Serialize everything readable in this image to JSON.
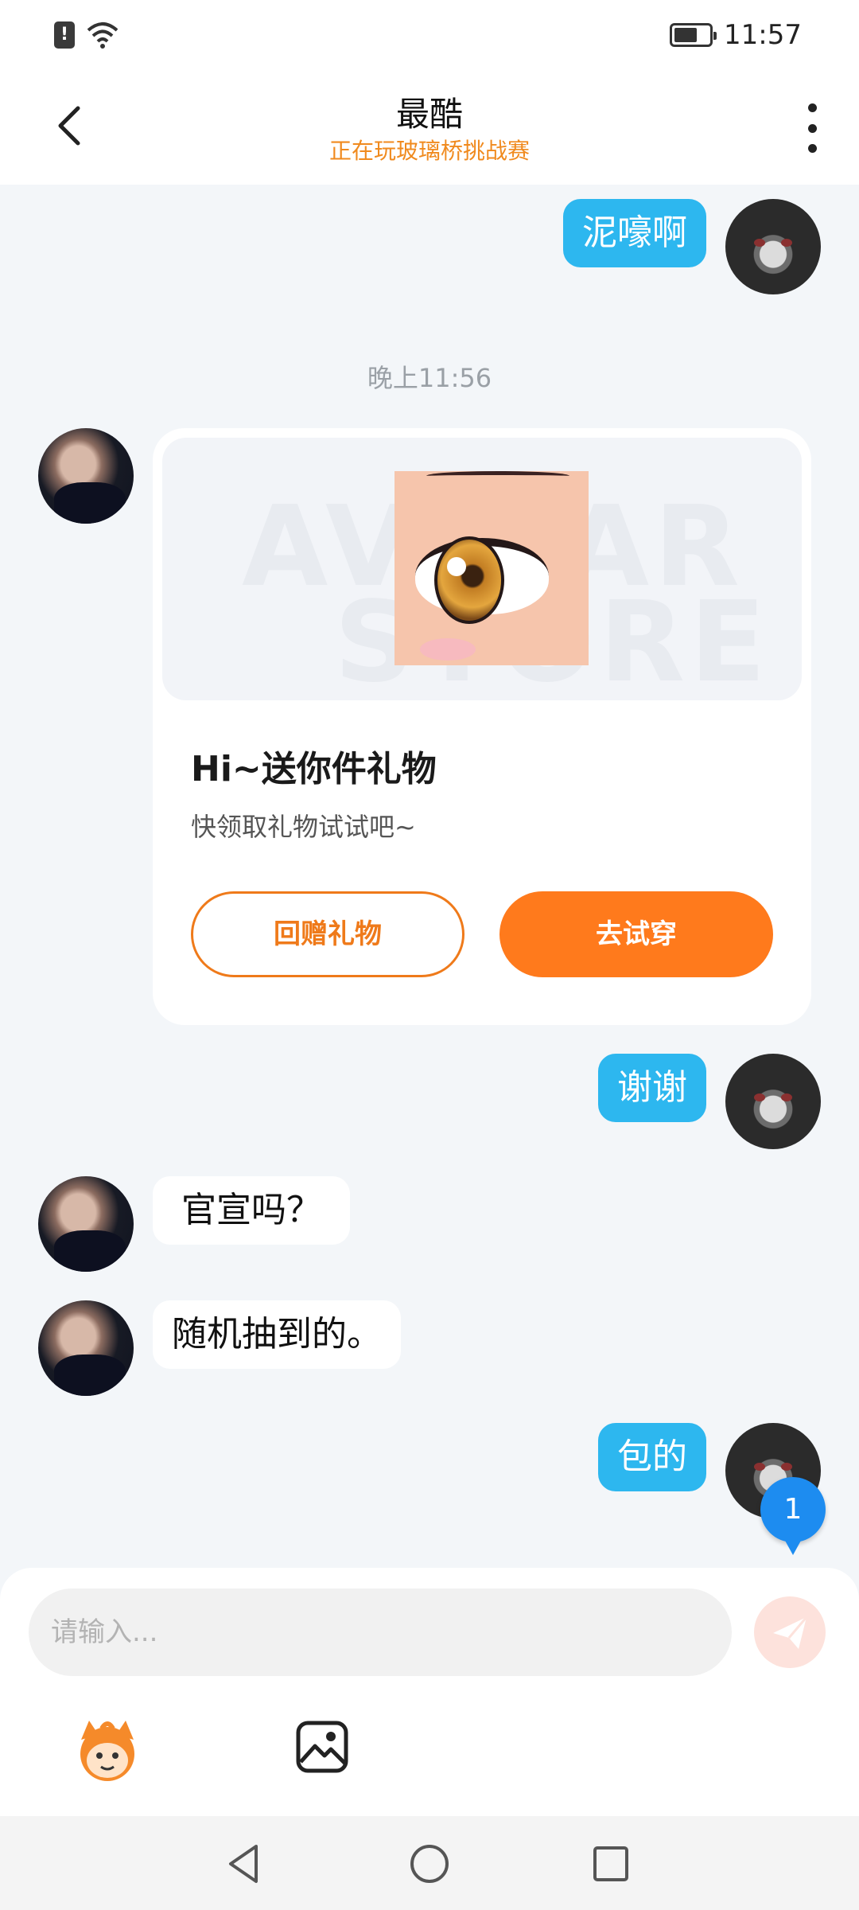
{
  "status_bar": {
    "time": "11:57",
    "icons": [
      "alert-icon",
      "wifi-icon",
      "battery-icon"
    ],
    "battery_level": 0.6
  },
  "header": {
    "title": "最酷",
    "subtitle": "正在玩玻璃桥挑战赛",
    "back_icon": "chevron-left-icon",
    "more_icon": "more-vertical-icon"
  },
  "messages": {
    "m1": {
      "sender": "me",
      "text": "泥嚎啊"
    },
    "timestamp": "晚上11:56",
    "gift": {
      "sender": "her",
      "title": "Hi~送你件礼物",
      "desc": "快领取礼物试试吧~",
      "return_label": "回赠礼物",
      "try_label": "去试穿",
      "watermark_line1": "AVATAR",
      "watermark_line2": "STORE"
    },
    "m2": {
      "sender": "me",
      "text": "谢谢"
    },
    "m3": {
      "sender": "her",
      "text": "官宣吗？"
    },
    "m4": {
      "sender": "her",
      "text": "随机抽到的。"
    },
    "m5": {
      "sender": "me",
      "text": "包的"
    }
  },
  "unread_badge": "1",
  "input": {
    "placeholder": "请输入...",
    "value": ""
  },
  "toolbar": {
    "icons": [
      "emoji-mascot-icon",
      "image-icon",
      "send-icon"
    ]
  },
  "nav_bar": {
    "icons": [
      "nav-back-icon",
      "nav-home-icon",
      "nav-recents-icon"
    ]
  },
  "colors": {
    "accent_orange": "#ff7a1c",
    "bubble_blue": "#2db7ef",
    "badge_blue": "#1d8cf0",
    "background": "#f3f6f9"
  }
}
